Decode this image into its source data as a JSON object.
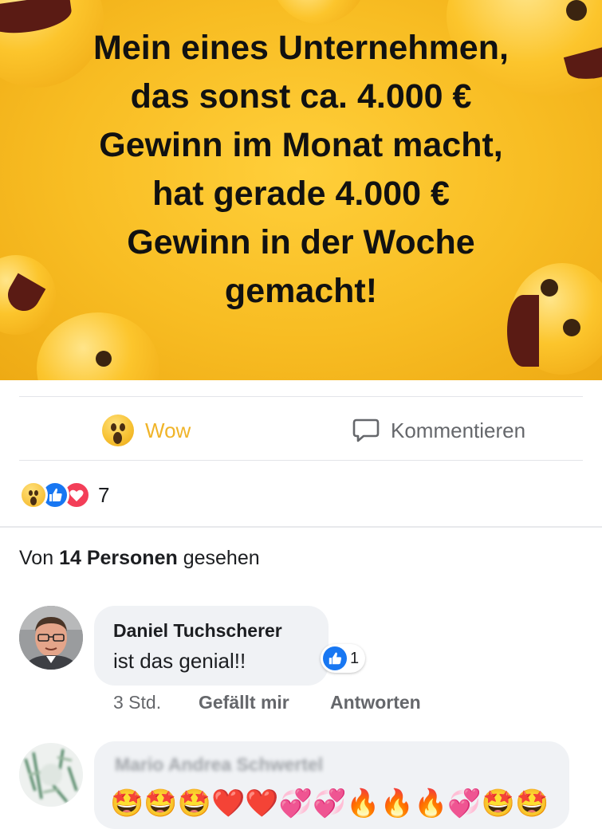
{
  "post": {
    "image_text": [
      "Mein eines Unternehmen,",
      "das sonst ca. 4.000 €",
      "Gewinn im Monat macht,",
      "hat gerade 4.000 €",
      "Gewinn in der Woche",
      "gemacht!"
    ],
    "image_background": "#f8bd23"
  },
  "actions": {
    "react_label": "Wow",
    "react_color": "#f0b429",
    "comment_label": "Kommentieren",
    "comment_color": "#65676b"
  },
  "reactions": {
    "types": [
      "wow",
      "like",
      "love"
    ],
    "count": "7"
  },
  "seen": {
    "prefix": "Von",
    "count": "14 Personen",
    "suffix": "gesehen"
  },
  "comments": [
    {
      "author": "Daniel Tuchscherer",
      "text": "ist das genial!!",
      "like_count": "1",
      "time": "3 Std.",
      "like_label": "Gefällt mir",
      "reply_label": "Antworten"
    },
    {
      "author": "Mario Andrea Schwertel",
      "text": "🤩🤩🤩❤️❤️💞💞🔥🔥🔥💞🤩🤩"
    }
  ],
  "colors": {
    "brand_blue": "#1877f2",
    "love_red": "#f33e58",
    "text_primary": "#1c1e21",
    "text_secondary": "#65676b",
    "bubble_bg": "#f0f2f5"
  }
}
